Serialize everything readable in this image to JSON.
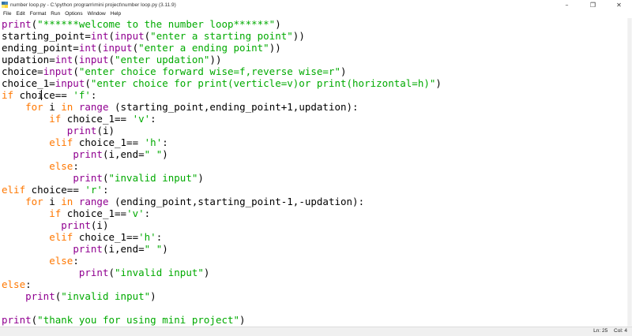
{
  "window": {
    "title": "number loop.py - C:\\python program\\mini project\\number loop.py (3.11.9)",
    "minimize_glyph": "–",
    "maximize_glyph": "❐",
    "close_glyph": "✕"
  },
  "menu": {
    "file": "File",
    "edit": "Edit",
    "format": "Format",
    "run": "Run",
    "options": "Options",
    "window": "Window",
    "help": "Help"
  },
  "code": {
    "colors": {
      "keyword": "#ff7700",
      "builtin": "#900090",
      "string": "#00aa00",
      "default": "#000000"
    },
    "lines": [
      [
        {
          "t": "print",
          "c": "bi"
        },
        {
          "t": "("
        },
        {
          "t": "\"******welcome to the number loop******\"",
          "c": "str"
        },
        {
          "t": ")"
        }
      ],
      [
        {
          "t": "starting_point="
        },
        {
          "t": "int",
          "c": "bi"
        },
        {
          "t": "("
        },
        {
          "t": "input",
          "c": "bi"
        },
        {
          "t": "("
        },
        {
          "t": "\"enter a starting point\"",
          "c": "str"
        },
        {
          "t": "))"
        }
      ],
      [
        {
          "t": "ending_point="
        },
        {
          "t": "int",
          "c": "bi"
        },
        {
          "t": "("
        },
        {
          "t": "input",
          "c": "bi"
        },
        {
          "t": "("
        },
        {
          "t": "\"enter a ending point\"",
          "c": "str"
        },
        {
          "t": "))"
        }
      ],
      [
        {
          "t": "updation="
        },
        {
          "t": "int",
          "c": "bi"
        },
        {
          "t": "("
        },
        {
          "t": "input",
          "c": "bi"
        },
        {
          "t": "("
        },
        {
          "t": "\"enter updation\"",
          "c": "str"
        },
        {
          "t": "))"
        }
      ],
      [
        {
          "t": "choice="
        },
        {
          "t": "input",
          "c": "bi"
        },
        {
          "t": "("
        },
        {
          "t": "\"enter choice forward wise=f,reverse wise=r\"",
          "c": "str"
        },
        {
          "t": ")"
        }
      ],
      [
        {
          "t": "choice_1="
        },
        {
          "t": "input",
          "c": "bi"
        },
        {
          "t": "("
        },
        {
          "t": "\"enter choice for print(verticle=v)or print(horizontal=h)\"",
          "c": "str"
        },
        {
          "t": ")"
        }
      ],
      [
        {
          "t": "if",
          "c": "kw"
        },
        {
          "t": " choice== "
        },
        {
          "t": "'f'",
          "c": "str"
        },
        {
          "t": ":"
        }
      ],
      [
        {
          "t": "    "
        },
        {
          "t": "for",
          "c": "kw"
        },
        {
          "t": " i "
        },
        {
          "t": "in",
          "c": "kw"
        },
        {
          "t": " "
        },
        {
          "t": "range",
          "c": "bi"
        },
        {
          "t": " (starting_point,ending_point+1,updation):"
        }
      ],
      [
        {
          "t": "        "
        },
        {
          "t": "if",
          "c": "kw"
        },
        {
          "t": " choice_1== "
        },
        {
          "t": "'v'",
          "c": "str"
        },
        {
          "t": ":"
        }
      ],
      [
        {
          "t": "           "
        },
        {
          "t": "print",
          "c": "bi"
        },
        {
          "t": "(i)"
        }
      ],
      [
        {
          "t": "        "
        },
        {
          "t": "elif",
          "c": "kw"
        },
        {
          "t": " choice_1== "
        },
        {
          "t": "'h'",
          "c": "str"
        },
        {
          "t": ":"
        }
      ],
      [
        {
          "t": "            "
        },
        {
          "t": "print",
          "c": "bi"
        },
        {
          "t": "(i,end="
        },
        {
          "t": "\" \"",
          "c": "str"
        },
        {
          "t": ")"
        }
      ],
      [
        {
          "t": "        "
        },
        {
          "t": "else",
          "c": "kw"
        },
        {
          "t": ":"
        }
      ],
      [
        {
          "t": "            "
        },
        {
          "t": "print",
          "c": "bi"
        },
        {
          "t": "("
        },
        {
          "t": "\"invalid input\"",
          "c": "str"
        },
        {
          "t": ")"
        }
      ],
      [
        {
          "t": "elif",
          "c": "kw"
        },
        {
          "t": " choice== "
        },
        {
          "t": "'r'",
          "c": "str"
        },
        {
          "t": ":"
        }
      ],
      [
        {
          "t": "    "
        },
        {
          "t": "for",
          "c": "kw"
        },
        {
          "t": " i "
        },
        {
          "t": "in",
          "c": "kw"
        },
        {
          "t": " "
        },
        {
          "t": "range",
          "c": "bi"
        },
        {
          "t": " (ending_point,starting_point-1,-updation):"
        }
      ],
      [
        {
          "t": "        "
        },
        {
          "t": "if",
          "c": "kw"
        },
        {
          "t": " choice_1=="
        },
        {
          "t": "'v'",
          "c": "str"
        },
        {
          "t": ":"
        }
      ],
      [
        {
          "t": "          "
        },
        {
          "t": "print",
          "c": "bi"
        },
        {
          "t": "(i)"
        }
      ],
      [
        {
          "t": "        "
        },
        {
          "t": "elif",
          "c": "kw"
        },
        {
          "t": " choice_1=="
        },
        {
          "t": "'h'",
          "c": "str"
        },
        {
          "t": ":"
        }
      ],
      [
        {
          "t": "            "
        },
        {
          "t": "print",
          "c": "bi"
        },
        {
          "t": "(i,end="
        },
        {
          "t": "\" \"",
          "c": "str"
        },
        {
          "t": ")"
        }
      ],
      [
        {
          "t": "        "
        },
        {
          "t": "else",
          "c": "kw"
        },
        {
          "t": ":"
        }
      ],
      [
        {
          "t": "             "
        },
        {
          "t": "print",
          "c": "bi"
        },
        {
          "t": "("
        },
        {
          "t": "\"invalid input\"",
          "c": "str"
        },
        {
          "t": ")"
        }
      ],
      [
        {
          "t": "else",
          "c": "kw"
        },
        {
          "t": ":"
        }
      ],
      [
        {
          "t": "    "
        },
        {
          "t": "print",
          "c": "bi"
        },
        {
          "t": "("
        },
        {
          "t": "\"invalid input\"",
          "c": "str"
        },
        {
          "t": ")"
        }
      ],
      [
        {
          "t": ""
        }
      ],
      [
        {
          "t": "print",
          "c": "bi"
        },
        {
          "t": "("
        },
        {
          "t": "\"thank you for using mini project\"",
          "c": "str"
        },
        {
          "t": ")"
        }
      ]
    ]
  },
  "status": {
    "line": "Ln: 25",
    "col": "Col: 4"
  }
}
